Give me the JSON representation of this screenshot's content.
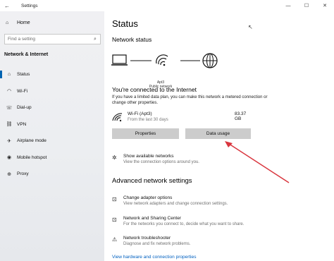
{
  "window": {
    "title": "Settings",
    "back_glyph": "←",
    "controls": {
      "minimize": "—",
      "maximize": "☐",
      "close": "✕"
    }
  },
  "sidebar": {
    "home_label": "Home",
    "search_placeholder": "Find a setting",
    "section_title": "Network & Internet",
    "items": [
      {
        "label": "Status",
        "icon": "status-icon",
        "glyph": "⌂",
        "active": true
      },
      {
        "label": "Wi-Fi",
        "icon": "wifi-icon",
        "glyph": "◠",
        "active": false
      },
      {
        "label": "Dial-up",
        "icon": "phone-icon",
        "glyph": "☏",
        "active": false
      },
      {
        "label": "VPN",
        "icon": "vpn-icon",
        "glyph": "⛓",
        "active": false
      },
      {
        "label": "Airplane mode",
        "icon": "airplane-icon",
        "glyph": "✈",
        "active": false
      },
      {
        "label": "Mobile hotspot",
        "icon": "hotspot-icon",
        "glyph": "◉",
        "active": false
      },
      {
        "label": "Proxy",
        "icon": "globe-icon",
        "glyph": "⊕",
        "active": false
      }
    ]
  },
  "main": {
    "title": "Status",
    "network_status_heading": "Network status",
    "network_name": "Apt3",
    "network_type": "Public network",
    "connected_heading": "You're connected to the Internet",
    "connected_desc": "If you have a limited data plan, you can make this network a metered connection or change other properties.",
    "wifi_name": "Wi-Fi (Apt3)",
    "wifi_period": "From the last 30 days",
    "wifi_usage": "83.37 GB",
    "properties_button": "Properties",
    "data_usage_button": "Data usage",
    "show_networks_title": "Show available networks",
    "show_networks_desc": "View the connection options around you.",
    "advanced_heading": "Advanced network settings",
    "adapter_title": "Change adapter options",
    "adapter_desc": "View network adapters and change connection settings.",
    "sharing_title": "Network and Sharing Center",
    "sharing_desc": "For the networks you connect to, decide what you want to share.",
    "troubleshooter_title": "Network troubleshooter",
    "troubleshooter_desc": "Diagnose and fix network problems.",
    "hardware_link": "View hardware and connection properties"
  },
  "colors": {
    "accent": "#0063b1",
    "annotation_arrow": "#d9363e",
    "link": "#0060c0"
  }
}
